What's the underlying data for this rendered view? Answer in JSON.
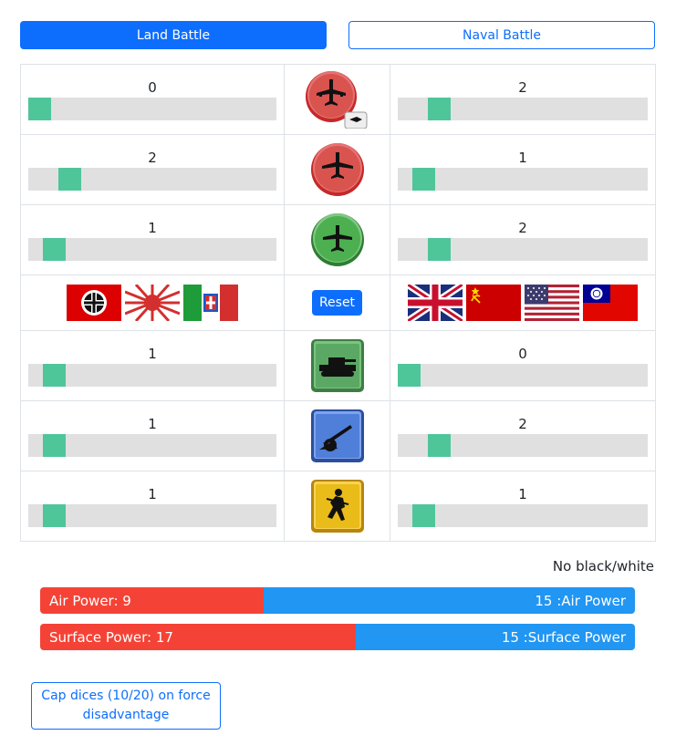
{
  "tabs": {
    "land": "Land Battle",
    "naval": "Naval Battle"
  },
  "rows": [
    {
      "unit": "strategic-bomber",
      "left": {
        "value": "0",
        "fraction": 0.0
      },
      "right": {
        "value": "2",
        "fraction": 0.12
      }
    },
    {
      "unit": "tactical-bomber",
      "left": {
        "value": "2",
        "fraction": 0.12
      },
      "right": {
        "value": "1",
        "fraction": 0.06
      }
    },
    {
      "unit": "fighter",
      "left": {
        "value": "1",
        "fraction": 0.06
      },
      "right": {
        "value": "2",
        "fraction": 0.12
      }
    },
    {
      "unit": "tank",
      "left": {
        "value": "1",
        "fraction": 0.06
      },
      "right": {
        "value": "0",
        "fraction": 0.0
      }
    },
    {
      "unit": "artillery",
      "left": {
        "value": "1",
        "fraction": 0.06
      },
      "right": {
        "value": "2",
        "fraction": 0.12
      }
    },
    {
      "unit": "infantry",
      "left": {
        "value": "1",
        "fraction": 0.06
      },
      "right": {
        "value": "1",
        "fraction": 0.06
      }
    }
  ],
  "reset_label": "Reset",
  "axis_flags": [
    "germany-flag",
    "japan-flag",
    "italy-flag"
  ],
  "allies_flags": [
    "uk-flag",
    "ussr-flag",
    "usa-flag",
    "china-flag"
  ],
  "bw_label": "No black/white",
  "power": {
    "air_left": "Air Power: 9",
    "air_right": "15 :Air Power",
    "air_left_share": 0.375,
    "surface_left": "Surface Power: 17",
    "surface_right": "15 :Surface Power",
    "surface_left_share": 0.531
  },
  "cap_button": "Cap dices (10/20) on force disadvantage",
  "colors": {
    "primary": "#0d6efd",
    "slider": "#4fc59a",
    "axis": "#f44336",
    "allies": "#2196f3"
  }
}
